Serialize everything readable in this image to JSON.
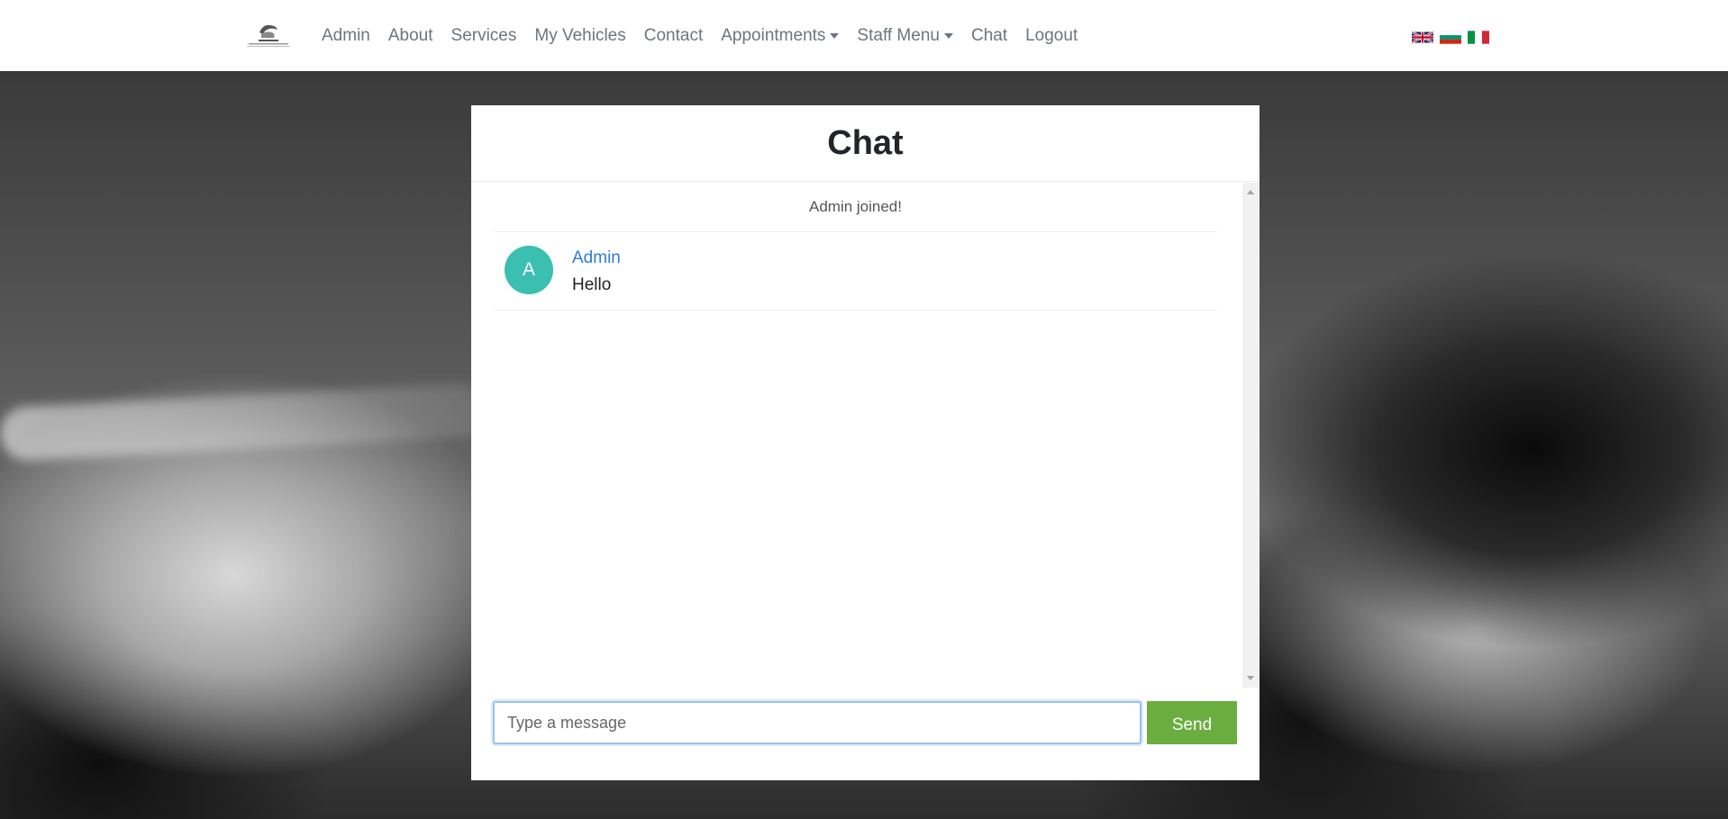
{
  "navbar": {
    "links": [
      {
        "label": "Admin"
      },
      {
        "label": "About"
      },
      {
        "label": "Services"
      },
      {
        "label": "My Vehicles"
      },
      {
        "label": "Contact"
      },
      {
        "label": "Appointments",
        "dropdown": true
      },
      {
        "label": "Staff Menu",
        "dropdown": true
      },
      {
        "label": "Chat"
      },
      {
        "label": "Logout"
      }
    ],
    "flags": [
      "uk-flag-icon",
      "bulgaria-flag-icon",
      "italy-flag-icon"
    ]
  },
  "chat": {
    "title": "Chat",
    "system_message": "Admin joined!",
    "messages": [
      {
        "avatar_letter": "A",
        "user": "Admin",
        "text": "Hello"
      }
    ],
    "input_placeholder": "Type a message",
    "send_label": "Send"
  },
  "colors": {
    "avatar": "#3bbfb0",
    "username": "#2e7ddb",
    "send_button": "#6aae3f",
    "input_border": "#9ac2f0"
  }
}
